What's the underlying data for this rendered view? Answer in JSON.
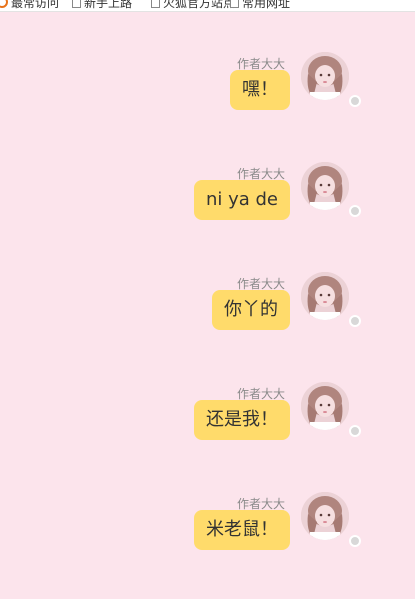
{
  "topbar": {
    "items": [
      {
        "icon": "browser-logo-icon",
        "label": "最常访问"
      },
      {
        "icon": "document-icon",
        "label": "新手上路"
      },
      {
        "icon": "document-icon",
        "label": "火狐官方站点"
      },
      {
        "icon": "document-icon",
        "label": "常用网址"
      }
    ]
  },
  "colors": {
    "background": "#fce4ec",
    "bubble": "#ffdb6b",
    "status_dot": "#d8d8d8"
  },
  "messages": [
    {
      "sender": "作者大大",
      "text": "嘿！",
      "avatar": "user-avatar",
      "status": "offline"
    },
    {
      "sender": "作者大大",
      "text": "ni ya de",
      "avatar": "user-avatar",
      "status": "offline"
    },
    {
      "sender": "作者大大",
      "text": "你丫的",
      "avatar": "user-avatar",
      "status": "offline"
    },
    {
      "sender": "作者大大",
      "text": "还是我！",
      "avatar": "user-avatar",
      "status": "offline"
    },
    {
      "sender": "作者大大",
      "text": "米老鼠！",
      "avatar": "user-avatar",
      "status": "offline"
    }
  ]
}
